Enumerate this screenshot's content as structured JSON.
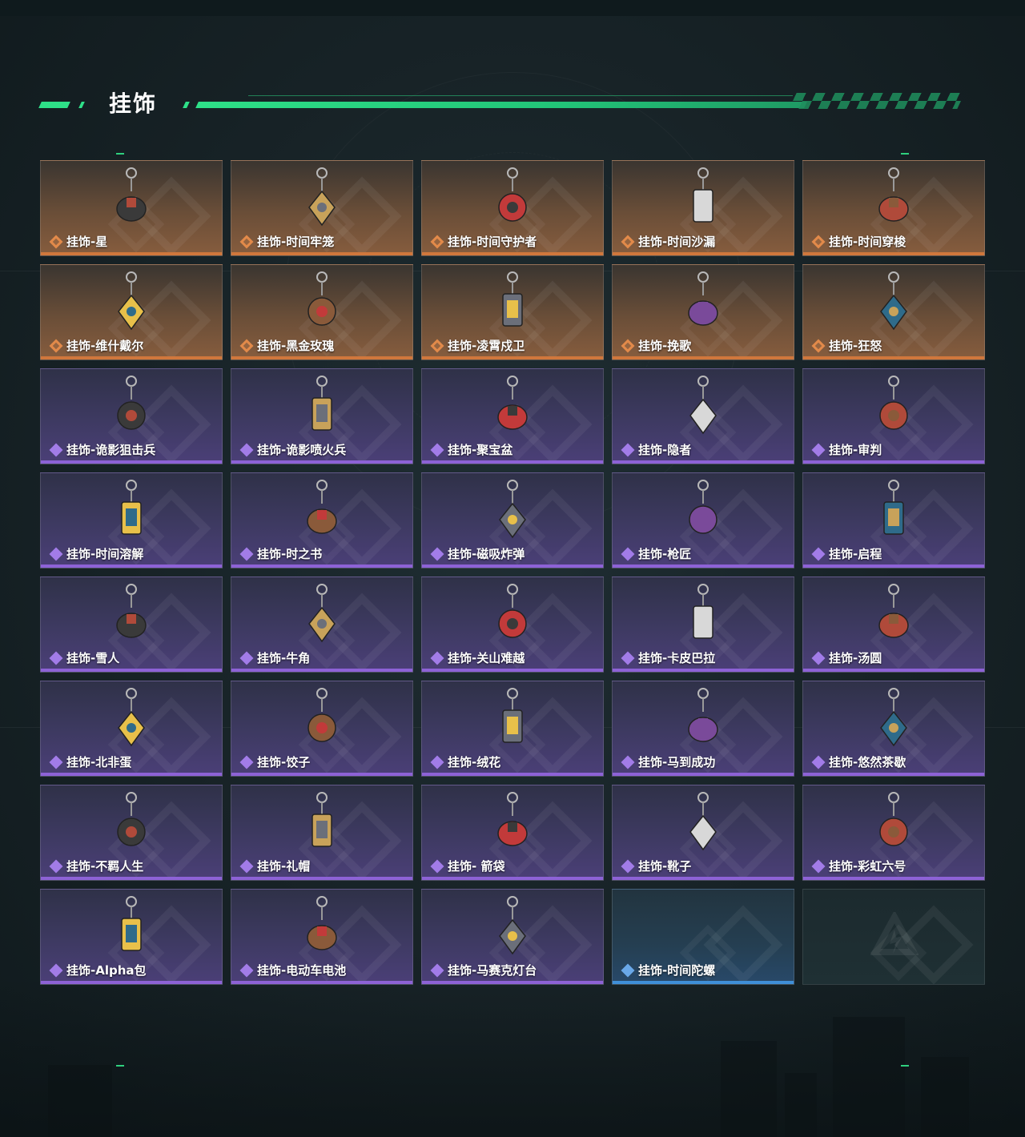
{
  "header": {
    "title": "挂饰"
  },
  "items": [
    {
      "name": "挂饰-星",
      "rarity": "gold",
      "icon": "tarot-card-charm-icon"
    },
    {
      "name": "挂饰-时间牢笼",
      "rarity": "gold",
      "icon": "cage-charm-icon"
    },
    {
      "name": "挂饰-时间守护者",
      "rarity": "gold",
      "icon": "guardian-charm-icon"
    },
    {
      "name": "挂饰-时间沙漏",
      "rarity": "gold",
      "icon": "hourglass-charm-icon"
    },
    {
      "name": "挂饰-时间穿梭",
      "rarity": "gold",
      "icon": "ring-charm-icon"
    },
    {
      "name": "挂饰-维什戴尔",
      "rarity": "gold",
      "icon": "tag-charm-icon"
    },
    {
      "name": "挂饰-黑金玫瑰",
      "rarity": "gold",
      "icon": "black-rose-charm-icon"
    },
    {
      "name": "挂饰-凌霄戍卫",
      "rarity": "gold",
      "icon": "figure-charm-icon"
    },
    {
      "name": "挂饰-挽歌",
      "rarity": "gold",
      "icon": "spire-charm-icon"
    },
    {
      "name": "挂饰-狂怒",
      "rarity": "gold",
      "icon": "rifle-charm-icon"
    },
    {
      "name": "挂饰-诡影狙击兵",
      "rarity": "purple",
      "icon": "sniper-charm-icon"
    },
    {
      "name": "挂饰-诡影喷火兵",
      "rarity": "purple",
      "icon": "flamethrower-charm-icon"
    },
    {
      "name": "挂饰-聚宝盆",
      "rarity": "purple",
      "icon": "treasure-bowl-charm-icon"
    },
    {
      "name": "挂饰-隐者",
      "rarity": "purple",
      "icon": "hermit-card-charm-icon"
    },
    {
      "name": "挂饰-审判",
      "rarity": "purple",
      "icon": "judgement-card-charm-icon"
    },
    {
      "name": "挂饰-时间溶解",
      "rarity": "purple",
      "icon": "melting-clock-charm-icon"
    },
    {
      "name": "挂饰-时之书",
      "rarity": "purple",
      "icon": "book-charm-icon"
    },
    {
      "name": "挂饰-磁吸炸弹",
      "rarity": "purple",
      "icon": "bomb-charm-icon"
    },
    {
      "name": "挂饰-枪匠",
      "rarity": "purple",
      "icon": "gunsmith-box-charm-icon"
    },
    {
      "name": "挂饰-启程",
      "rarity": "purple",
      "icon": "emblem-charm-icon"
    },
    {
      "name": "挂饰-雪人",
      "rarity": "purple",
      "icon": "snowman-charm-icon"
    },
    {
      "name": "挂饰-牛角",
      "rarity": "purple",
      "icon": "horns-charm-icon"
    },
    {
      "name": "挂饰-关山难越",
      "rarity": "purple",
      "icon": "lighter-charm-icon"
    },
    {
      "name": "挂饰-卡皮巴拉",
      "rarity": "purple",
      "icon": "capybara-charm-icon"
    },
    {
      "name": "挂饰-汤圆",
      "rarity": "purple",
      "icon": "dumpling-bowl-charm-icon"
    },
    {
      "name": "挂饰-北非蛋",
      "rarity": "purple",
      "icon": "shakshuka-charm-icon"
    },
    {
      "name": "挂饰-饺子",
      "rarity": "purple",
      "icon": "dumplings-plate-charm-icon"
    },
    {
      "name": "挂饰-绒花",
      "rarity": "purple",
      "icon": "velvet-flower-charm-icon"
    },
    {
      "name": "挂饰-马到成功",
      "rarity": "purple",
      "icon": "horse-charm-icon"
    },
    {
      "name": "挂饰-悠然茶歇",
      "rarity": "purple",
      "icon": "cupcake-charm-icon"
    },
    {
      "name": "挂饰-不羁人生",
      "rarity": "purple",
      "icon": "sneaker-charm-icon"
    },
    {
      "name": "挂饰-礼帽",
      "rarity": "purple",
      "icon": "fedora-charm-icon"
    },
    {
      "name": "挂饰- 箭袋",
      "rarity": "purple",
      "icon": "quiver-charm-icon"
    },
    {
      "name": "挂饰-靴子",
      "rarity": "purple",
      "icon": "boot-charm-icon"
    },
    {
      "name": "挂饰-彩虹六号",
      "rarity": "purple",
      "icon": "six-charm-icon"
    },
    {
      "name": "挂饰-Alpha包",
      "rarity": "purple",
      "icon": "bag-charm-icon"
    },
    {
      "name": "挂饰-电动车电池",
      "rarity": "purple",
      "icon": "battery-charm-icon"
    },
    {
      "name": "挂饰-马赛克灯台",
      "rarity": "purple",
      "icon": "mosaic-lamp-charm-icon"
    },
    {
      "name": "挂饰-时间陀螺",
      "rarity": "blue",
      "icon": ""
    },
    {
      "name": "",
      "rarity": "empty",
      "icon": "brand-logo-icon"
    }
  ],
  "colors": {
    "accent": "#2ee088",
    "gold": "#d0773c",
    "purple": "#8d62d6",
    "blue": "#3f8fd8"
  }
}
